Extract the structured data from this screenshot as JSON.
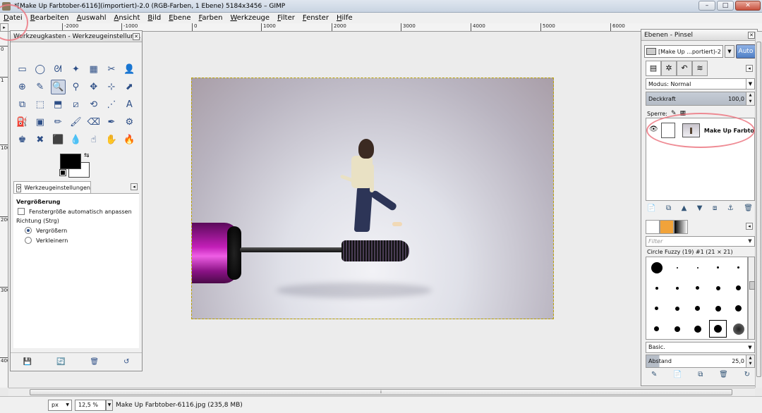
{
  "window": {
    "title": "*[Make Up Farbtober-6116](importiert)-2.0 (RGB-Farben, 1 Ebene) 5184x3456 – GIMP",
    "minimize": "–",
    "maximize": "□",
    "close": "✕"
  },
  "menubar": [
    "Datei",
    "Bearbeiten",
    "Auswahl",
    "Ansicht",
    "Bild",
    "Ebene",
    "Farben",
    "Werkzeuge",
    "Filter",
    "Fenster",
    "Hilfe"
  ],
  "ruler_top": [
    "-2000",
    "-1000",
    "0",
    "1000",
    "2000",
    "3000",
    "4000",
    "5000",
    "6000"
  ],
  "ruler_left": [
    "0",
    "1",
    "1000",
    "2000",
    "3000",
    "4000"
  ],
  "toolbox": {
    "title": "Werkzeugkasten - Werkzeugeinstellun...",
    "tools": [
      "▭",
      "◯",
      "ᘛ",
      "✦",
      "▦",
      "✂",
      "👤",
      "⊕",
      "✎",
      "🔍",
      "⚲",
      "✥",
      "⊹",
      "⬈",
      "⧉",
      "⬚",
      "⬒",
      "⧄",
      "⟲",
      "⋰",
      "A",
      "⛽",
      "▣",
      "✏",
      "🖌",
      "⌫",
      "✒",
      "⚙",
      "♚",
      "✖",
      "⬛",
      "💧",
      "☝",
      "✋",
      "🔥"
    ],
    "options_tab": "Werkzeugeinstellungen",
    "options_heading": "Vergrößerung",
    "auto_resize_label": "Fenstergröße automatisch anpassen",
    "direction_label": "Richtung  (Strg)",
    "zoom_in_label": "Vergrößern",
    "zoom_out_label": "Verkleinern",
    "footer_icons": [
      "💾",
      "🔄",
      "🗑",
      "↺"
    ]
  },
  "layers": {
    "title": "Ebenen - Pinsel",
    "image_select": "[Make Up ...portiert)-2",
    "auto_label": "Auto",
    "mode_label": "Modus: Normal",
    "opacity_label": "Deckkraft",
    "opacity_value": "100,0",
    "lock_label": "Sperre:",
    "layer_name": "Make Up Farbtober",
    "layer_buttons": [
      "📄",
      "⧉",
      "▲",
      "▼",
      "⧈",
      "⚓",
      "🗑"
    ],
    "filter_placeholder": "Filter",
    "brush_name": "Circle Fuzzy (19) #1 (21 × 21)",
    "brush_preset": "Basic.",
    "spacing_label": "Abstand",
    "spacing_value": "25,0",
    "brush_buttons": [
      "✎",
      "📄",
      "⧉",
      "🗑",
      "↻"
    ]
  },
  "statusbar": {
    "units": "px",
    "zoom": "12,5 %",
    "text": "Make Up Farbtober-6116.jpg (235,8 MB)"
  },
  "colors": {
    "foreground": "#000000",
    "background": "#ffffff",
    "annotation": "#ec7882"
  }
}
